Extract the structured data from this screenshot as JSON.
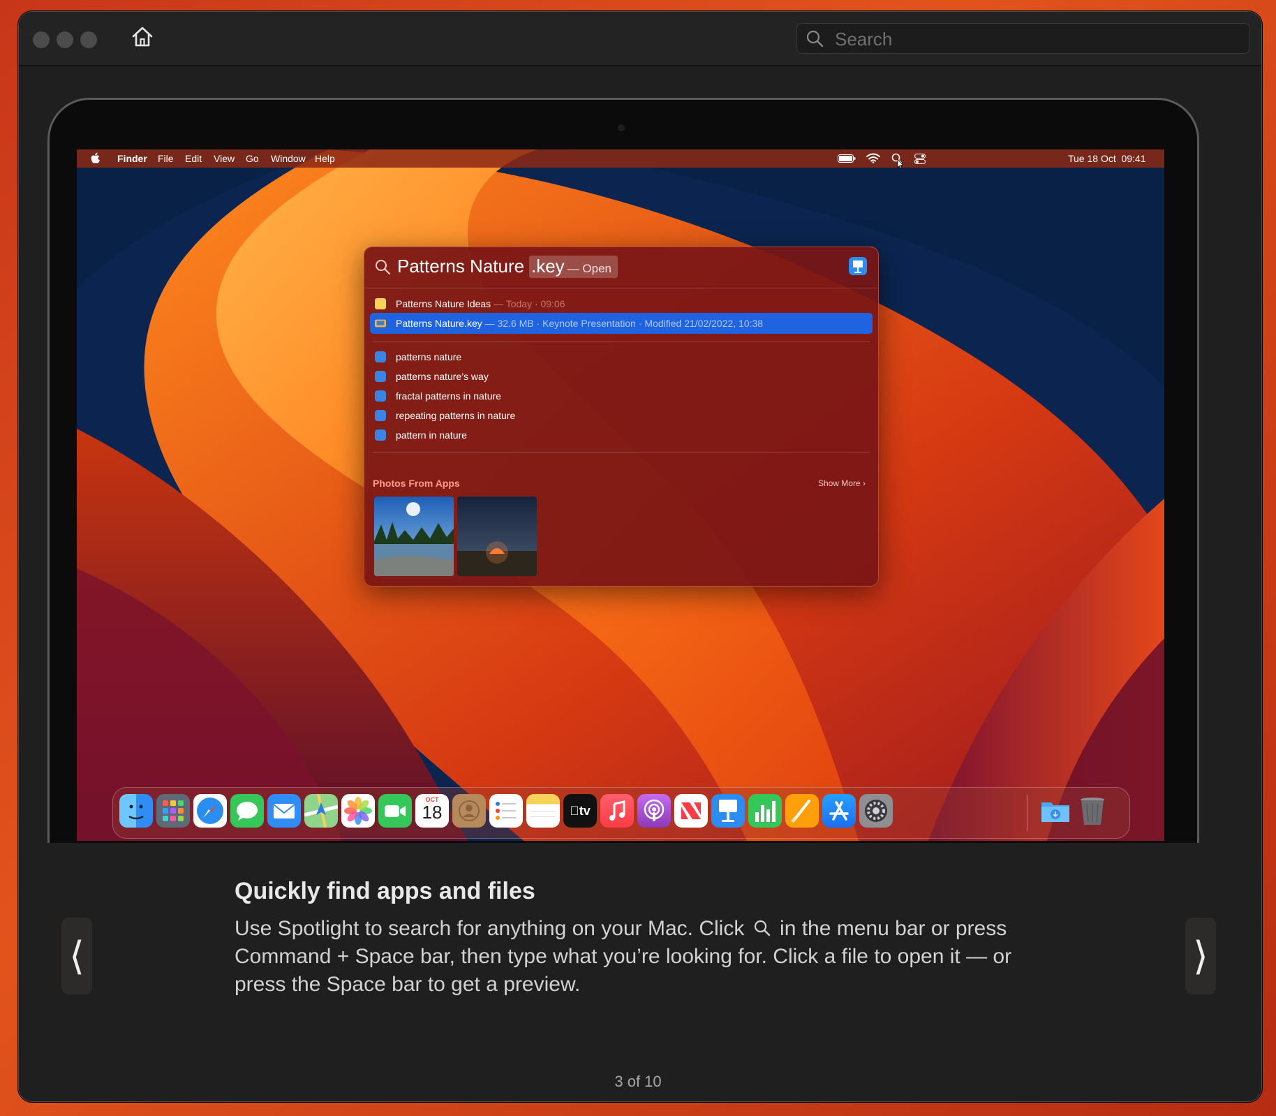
{
  "window": {
    "search": {
      "placeholder": "Search"
    }
  },
  "menubar": {
    "app_name": "Finder",
    "items": [
      "File",
      "Edit",
      "View",
      "Go",
      "Window",
      "Help"
    ],
    "clock": "Tue 18 Oct  09:41",
    "icons": [
      "apple-icon",
      "battery-icon",
      "wifi-icon",
      "spotlight-icon",
      "control-center-icon"
    ]
  },
  "spotlight": {
    "query": "Patterns Nature",
    "completion": ".key",
    "action": "— Open",
    "top_results": [
      {
        "name": "Patterns Nature Ideas",
        "meta": " — Today · 09:06",
        "icon": "notes-icon"
      },
      {
        "name": "Patterns Nature.key",
        "meta": " — 32.6 MB · Keynote Presentation · Modified 21/02/2022, 10:38",
        "icon": "keynote-file-icon"
      }
    ],
    "suggestions": [
      "patterns nature",
      "patterns nature’s way",
      "fractal patterns in nature",
      "repeating patterns in nature",
      "pattern in nature"
    ],
    "photos_section": {
      "title": "Photos From Apps",
      "show_more": "Show More"
    }
  },
  "dock": {
    "apps": [
      "Finder",
      "Launchpad",
      "Safari",
      "Messages",
      "Mail",
      "Maps",
      "Photos",
      "FaceTime",
      "Calendar",
      "Contacts",
      "Reminders",
      "Notes",
      "TV",
      "Music",
      "Podcasts",
      "News",
      "Keynote",
      "Numbers",
      "Pages",
      "App Store",
      "System Settings",
      "Downloads",
      "Trash"
    ],
    "calendar": {
      "month": "OCT",
      "day": "18"
    },
    "tv_label": "tv"
  },
  "tip": {
    "title": "Quickly find apps and files",
    "body_part1": "Use Spotlight to search for anything on your Mac. Click",
    "body_part2": "in the menu bar or press Command + Space bar, then type what you’re looking for. Click a file to open it — or press the Space bar to get a preview."
  },
  "navigation": {
    "prev": "⟨",
    "next": "⟩",
    "page": "3 of 10"
  }
}
